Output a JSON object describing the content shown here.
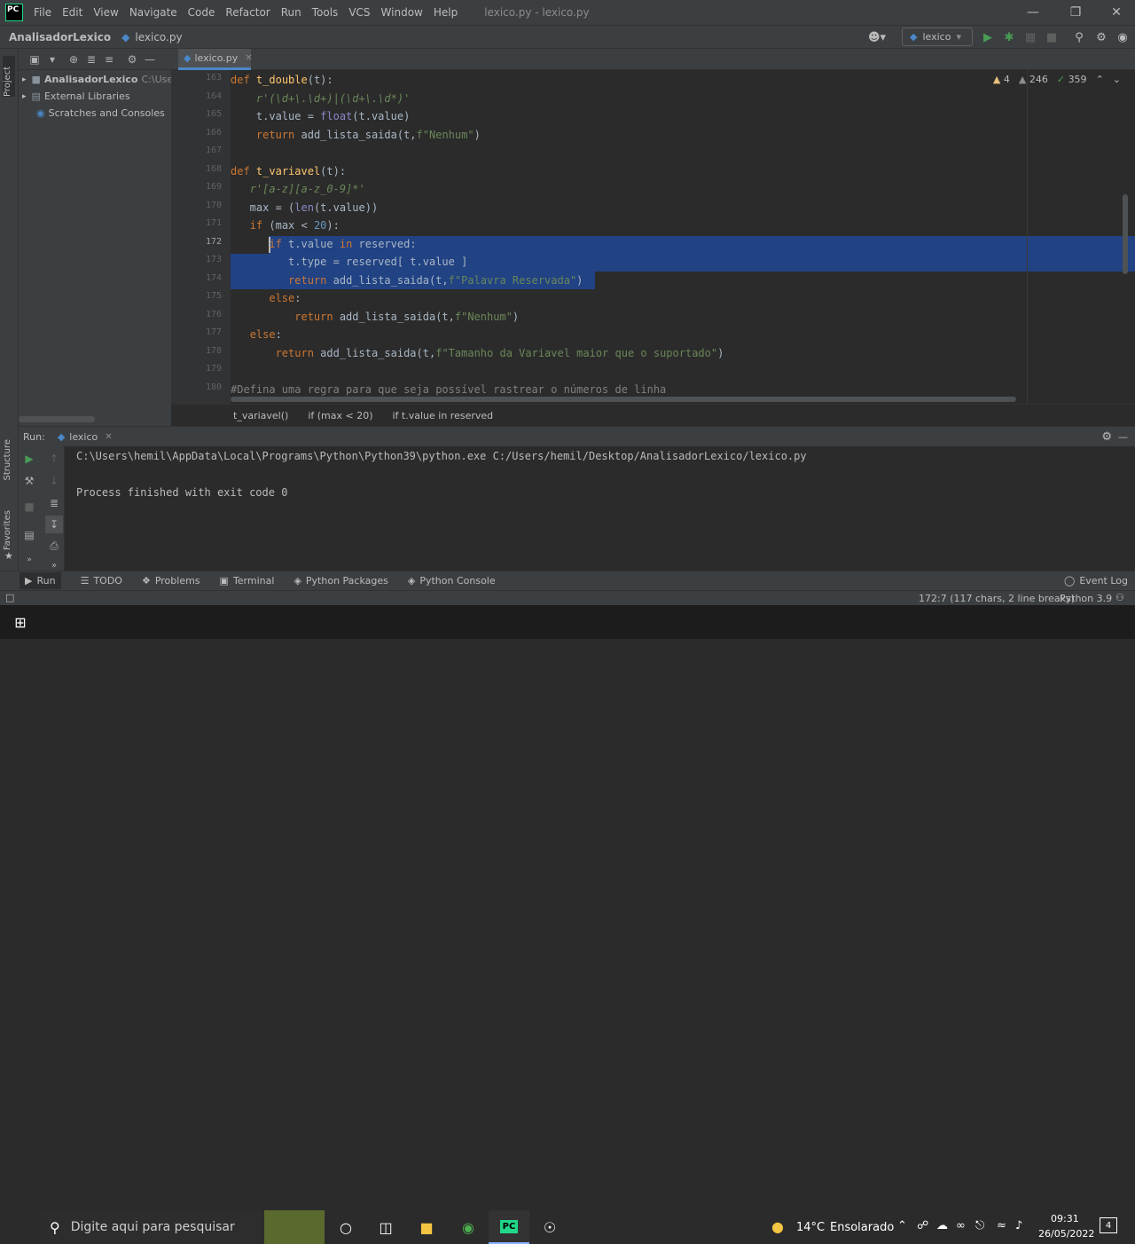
{
  "menu": {
    "items": [
      "File",
      "Edit",
      "View",
      "Navigate",
      "Code",
      "Refactor",
      "Run",
      "Tools",
      "VCS",
      "Window",
      "Help"
    ],
    "window_title": "lexico.py - lexico.py",
    "logo_text": "PC"
  },
  "navbar": {
    "project": "AnalisadorLexico",
    "file": "lexico.py",
    "run_config": "lexico"
  },
  "project_panel": {
    "tab_label": "Project",
    "root_name": "AnalisadorLexico",
    "root_path": "C:\\Users",
    "external_libraries": "External Libraries",
    "scratches": "Scratches and Consoles"
  },
  "editor": {
    "tab_label": "lexico.py",
    "inspections": {
      "warnings": "4",
      "weak_warnings": "246",
      "ok": "359"
    },
    "line_numbers": [
      "163",
      "164",
      "165",
      "166",
      "167",
      "168",
      "169",
      "170",
      "171",
      "172",
      "173",
      "174",
      "175",
      "176",
      "177",
      "178",
      "179",
      "180"
    ],
    "breadcrumbs": [
      "t_variavel()",
      "if (max < 20)",
      "if t.value in reserved"
    ]
  },
  "run_panel": {
    "label": "Run:",
    "config": "lexico",
    "command": "C:\\Users\\hemil\\AppData\\Local\\Programs\\Python\\Python39\\python.exe C:/Users/hemil/Desktop/AnalisadorLexico/lexico.py",
    "exit_message": "Process finished with exit code 0"
  },
  "left_strip": {
    "structure": "Structure",
    "favorites": "Favorites"
  },
  "bottom_tabs": {
    "run": "Run",
    "todo": "TODO",
    "problems": "Problems",
    "terminal": "Terminal",
    "python_packages": "Python Packages",
    "python_console": "Python Console",
    "event_log": "Event Log"
  },
  "status": {
    "position": "172:7 (117 chars, 2 line breaks)",
    "interpreter": "Python 3.9"
  },
  "taskbar": {
    "search_placeholder": "Digite aqui para pesquisar",
    "weather_temp": "14°C",
    "weather_desc": "Ensolarado",
    "time": "09:31",
    "date": "26/05/2022",
    "notification_count": "4"
  }
}
